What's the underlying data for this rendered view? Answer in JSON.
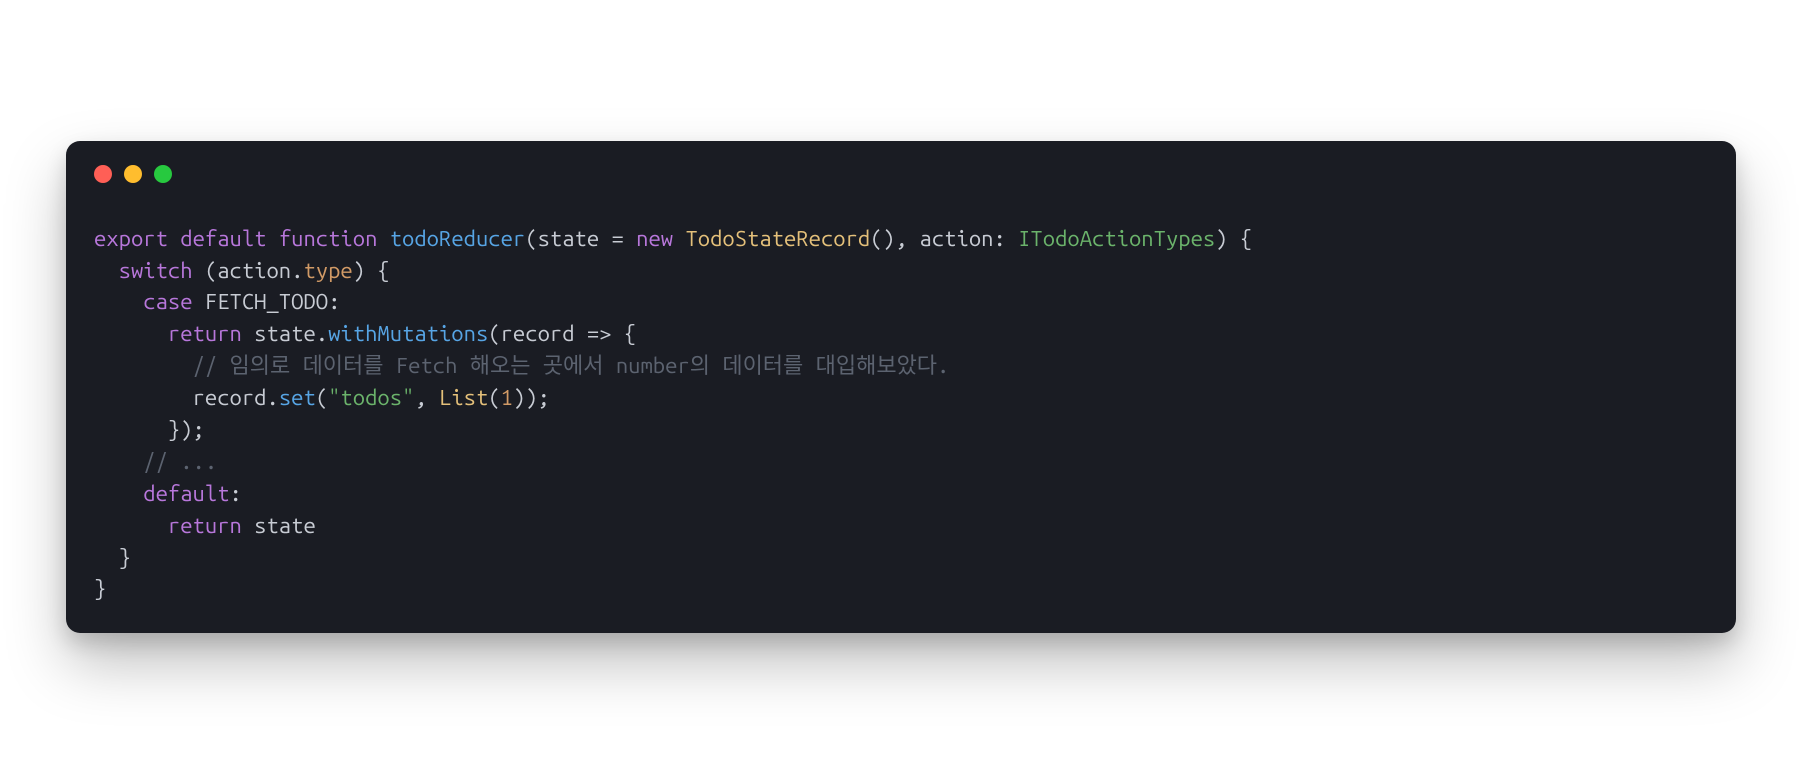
{
  "window": {
    "traffic_lights": {
      "red": "#ff5f56",
      "yellow": "#ffbd2e",
      "green": "#27c93f"
    }
  },
  "code": {
    "line1": {
      "export": "export",
      "default": "default",
      "function": "function",
      "funcname": "todoReducer",
      "paren_open": "(",
      "param1": "state",
      "eq": " = ",
      "new": "new",
      "ctor": "TodoStateRecord",
      "ctor_call": "()",
      "comma": ", ",
      "param2": "action",
      "colon": ": ",
      "type": "ITodoActionTypes",
      "paren_close": ")",
      "brace_open": " {"
    },
    "line2": {
      "indent": "  ",
      "switch": "switch",
      "paren_open": " (",
      "obj": "action",
      "dot": ".",
      "prop": "type",
      "paren_close": ")",
      "brace_open": " {"
    },
    "line3": {
      "indent": "    ",
      "case": "case",
      "sp": " ",
      "const": "FETCH_TODO",
      "colon": ":"
    },
    "line4": {
      "indent": "      ",
      "return": "return",
      "sp": " ",
      "obj": "state",
      "dot": ".",
      "method": "withMutations",
      "paren_open": "(",
      "param": "record",
      "arrow": " => ",
      "brace_open": "{"
    },
    "line5": {
      "indent": "        ",
      "comment": "// 임의로 데이터를 Fetch 해오는 곳에서 number의 데이터를 대입해보았다."
    },
    "line6": {
      "indent": "        ",
      "obj": "record",
      "dot": ".",
      "method": "set",
      "paren_open": "(",
      "str": "\"todos\"",
      "comma": ", ",
      "call": "List",
      "paren_open2": "(",
      "num": "1",
      "paren_close2": ")",
      "paren_close": ")",
      "semi": ";"
    },
    "line7": {
      "indent": "      ",
      "close": "});"
    },
    "line8": {
      "indent": "    ",
      "comment": "// ..."
    },
    "line9": {
      "indent": "    ",
      "default": "default",
      "colon": ":"
    },
    "line10": {
      "indent": "      ",
      "return": "return",
      "sp": " ",
      "obj": "state"
    },
    "line11": {
      "indent": "  ",
      "close": "}"
    },
    "line12": {
      "close": "}"
    }
  }
}
